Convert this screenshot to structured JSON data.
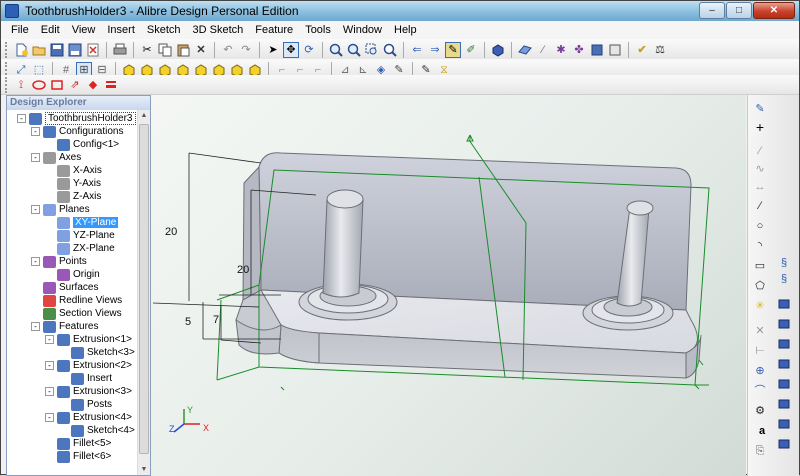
{
  "window": {
    "title": "ToothbrushHolder3 - Alibre Design Personal Edition",
    "minimize": "–",
    "maximize": "□",
    "close": "✕"
  },
  "menu": [
    "File",
    "Edit",
    "View",
    "Insert",
    "Sketch",
    "3D Sketch",
    "Feature",
    "Tools",
    "Window",
    "Help"
  ],
  "panel": {
    "title": "Design Explorer"
  },
  "tree": [
    {
      "label": "ToothbrushHolder3",
      "level": 0,
      "exp": "-",
      "icon": "part-icon",
      "focus": true
    },
    {
      "label": "Configurations",
      "level": 1,
      "exp": "-",
      "icon": "configurations-icon"
    },
    {
      "label": "Config<1>",
      "level": 2,
      "exp": "",
      "icon": "config-icon"
    },
    {
      "label": "Axes",
      "level": 1,
      "exp": "-",
      "icon": "axes-icon"
    },
    {
      "label": "X-Axis",
      "level": 2,
      "exp": "",
      "icon": "axis-icon"
    },
    {
      "label": "Y-Axis",
      "level": 2,
      "exp": "",
      "icon": "axis-icon"
    },
    {
      "label": "Z-Axis",
      "level": 2,
      "exp": "",
      "icon": "axis-icon"
    },
    {
      "label": "Planes",
      "level": 1,
      "exp": "-",
      "icon": "planes-icon"
    },
    {
      "label": "XY-Plane",
      "level": 2,
      "exp": "",
      "icon": "plane-icon",
      "selected": true
    },
    {
      "label": "YZ-Plane",
      "level": 2,
      "exp": "",
      "icon": "plane-icon"
    },
    {
      "label": "ZX-Plane",
      "level": 2,
      "exp": "",
      "icon": "plane-icon"
    },
    {
      "label": "Points",
      "level": 1,
      "exp": "-",
      "icon": "points-icon"
    },
    {
      "label": "Origin",
      "level": 2,
      "exp": "",
      "icon": "origin-icon"
    },
    {
      "label": "Surfaces",
      "level": 1,
      "exp": "",
      "icon": "surfaces-icon"
    },
    {
      "label": "Redline Views",
      "level": 1,
      "exp": "",
      "icon": "redline-icon"
    },
    {
      "label": "Section Views",
      "level": 1,
      "exp": "",
      "icon": "section-icon"
    },
    {
      "label": "Features",
      "level": 1,
      "exp": "-",
      "icon": "features-icon"
    },
    {
      "label": "Extrusion<1>",
      "level": 2,
      "exp": "-",
      "icon": "extrusion-icon"
    },
    {
      "label": "Sketch<3>",
      "level": 3,
      "exp": "",
      "icon": "sketch-icon"
    },
    {
      "label": "Extrusion<2>",
      "level": 2,
      "exp": "-",
      "icon": "extrusion-icon"
    },
    {
      "label": "Insert",
      "level": 3,
      "exp": "",
      "icon": "sketch-icon"
    },
    {
      "label": "Extrusion<3>",
      "level": 2,
      "exp": "-",
      "icon": "extrusion-icon"
    },
    {
      "label": "Posts",
      "level": 3,
      "exp": "",
      "icon": "sketch-icon"
    },
    {
      "label": "Extrusion<4>",
      "level": 2,
      "exp": "-",
      "icon": "extrusion-icon"
    },
    {
      "label": "Sketch<4>",
      "level": 3,
      "exp": "",
      "icon": "sketch-icon"
    },
    {
      "label": "Fillet<5>",
      "level": 2,
      "exp": "",
      "icon": "fillet-icon"
    },
    {
      "label": "Fillet<6>",
      "level": 2,
      "exp": "",
      "icon": "fillet-icon"
    }
  ],
  "dimensions": {
    "height_20a": "20",
    "height_20b": "20",
    "depth_5": "5",
    "depth_7": "7"
  },
  "triad": {
    "x": "X",
    "y": "Y",
    "z": "Z"
  },
  "colors": {
    "plane_outline": "#1a8c2a",
    "model_face": "#d9dade",
    "model_edge": "#6d6f77",
    "selection": "#3399ff"
  }
}
